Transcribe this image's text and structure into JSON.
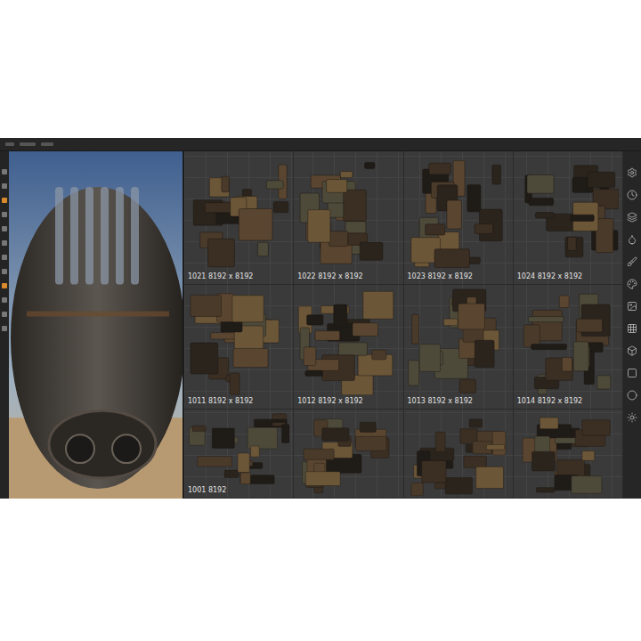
{
  "uv_view": {
    "rows": [
      [
        {
          "label": "1021 8192 x 8192"
        },
        {
          "label": "1022 8192 x 8192"
        },
        {
          "label": "1023 8192 x 8192"
        },
        {
          "label": "1024 8192 x 8192"
        }
      ],
      [
        {
          "label": "1011 8192 x 8192"
        },
        {
          "label": "1012 8192 x 8192"
        },
        {
          "label": "1013 8192 x 8192"
        },
        {
          "label": "1014 8192 x 8192"
        }
      ],
      [
        {
          "label": "1001 8192"
        },
        {},
        {},
        {}
      ]
    ]
  }
}
